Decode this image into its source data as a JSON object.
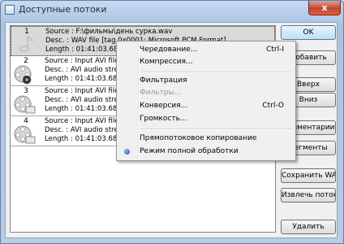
{
  "window": {
    "title": "Доступные потоки",
    "close_label": "x"
  },
  "streams": [
    {
      "number": "1",
      "source": "Source : F:\\фильмы\\день сурка.wav",
      "desc": "Desc. : WAV file [tag 0x0001: Microsoft PCM Format]",
      "length": "Length : 01:41:03.680",
      "selected": true
    },
    {
      "number": "2",
      "source": "Source : Input AVI file",
      "desc": "Desc. : AVI audio stream",
      "length": "Length : 01:41:03.683",
      "selected": false
    },
    {
      "number": "3",
      "source": "Source : Input AVI file",
      "desc": "Desc. : AVI audio stream",
      "length": "Length : 01:41:03.683",
      "selected": false
    },
    {
      "number": "4",
      "source": "Source : Input AVI file",
      "desc": "Desc. : AVI audio stream",
      "length": "Length : 01:41:03.683",
      "selected": false
    }
  ],
  "buttons": {
    "ok": "OK",
    "add": "Добавить",
    "up": "Вверх",
    "down": "Вниз",
    "comments": "Комментарии",
    "segments": "Сегменты",
    "save_wav": "Сохранить WAV",
    "extract": "Извлечь поток",
    "delete": "Удалить"
  },
  "context_menu": {
    "interleave": {
      "label": "Чередование...",
      "shortcut": "Ctrl-I"
    },
    "compression": {
      "label": "Компрессия..."
    },
    "filtering": {
      "label": "Фильтрация"
    },
    "filters": {
      "label": "Фильтры...",
      "disabled": true
    },
    "conversion": {
      "label": "Конверсия...",
      "shortcut": "Ctrl-O"
    },
    "volume": {
      "label": "Громкость..."
    },
    "direct_copy": {
      "label": "Прямопотоковое копирование"
    },
    "full_processing": {
      "label": "Режим полной обработки",
      "checked": true
    }
  }
}
